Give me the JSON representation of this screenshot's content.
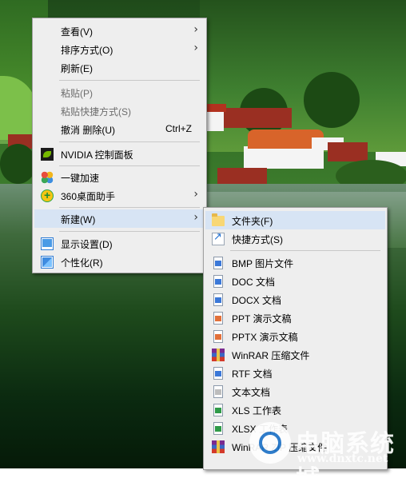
{
  "main_menu": {
    "view": "查看(V)",
    "sort": "排序方式(O)",
    "refresh": "刷新(E)",
    "paste": "粘贴(P)",
    "paste_shortcut": "粘贴快捷方式(S)",
    "undo": "撤消 删除(U)",
    "undo_shortcut": "Ctrl+Z",
    "nvidia": "NVIDIA 控制面板",
    "speedup": "一键加速",
    "desk360": "360桌面助手",
    "new": "新建(W)",
    "display": "显示设置(D)",
    "personalize": "个性化(R)"
  },
  "new_submenu": {
    "items": [
      {
        "label": "文件夹(F)",
        "icon": "folder-icon"
      },
      {
        "label": "快捷方式(S)",
        "icon": "shortcut-icon"
      },
      {
        "label": "BMP 图片文件",
        "icon": "bmp-file-icon"
      },
      {
        "label": "DOC 文档",
        "icon": "doc-file-icon"
      },
      {
        "label": "DOCX 文档",
        "icon": "docx-file-icon"
      },
      {
        "label": "PPT 演示文稿",
        "icon": "ppt-file-icon"
      },
      {
        "label": "PPTX 演示文稿",
        "icon": "pptx-file-icon"
      },
      {
        "label": "WinRAR 压缩文件",
        "icon": "winrar-icon"
      },
      {
        "label": "RTF 文档",
        "icon": "rtf-file-icon"
      },
      {
        "label": "文本文档",
        "icon": "txt-file-icon"
      },
      {
        "label": "XLS 工作表",
        "icon": "xls-file-icon"
      },
      {
        "label": "XLSX 工作表",
        "icon": "xlsx-file-icon"
      },
      {
        "label": "WinRAR ZIP 压缩文件",
        "icon": "winrar-zip-icon"
      }
    ]
  },
  "watermark": {
    "text": "电脑系统城",
    "url": "www.dnxtc.net"
  },
  "colors": {
    "menu_bg": "#eeeeee",
    "highlight": "#d7e4f4",
    "disabled_text": "#6d6d6d"
  }
}
